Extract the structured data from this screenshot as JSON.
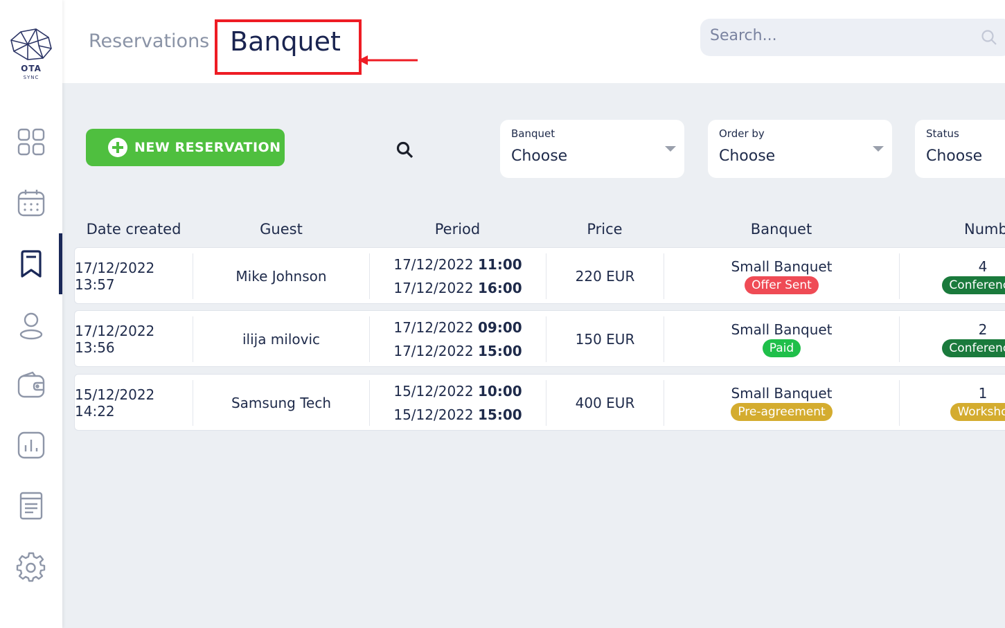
{
  "logo": {
    "line1": "OTA",
    "line2": "SYNC"
  },
  "sidebar": {
    "items": [
      {
        "icon": "dashboard-icon"
      },
      {
        "icon": "calendar-icon"
      },
      {
        "icon": "bookmark-icon",
        "active": true
      },
      {
        "icon": "user-icon"
      },
      {
        "icon": "wallet-icon"
      },
      {
        "icon": "chart-icon"
      },
      {
        "icon": "document-icon"
      },
      {
        "icon": "gear-icon"
      }
    ]
  },
  "header": {
    "breadcrumb": "Reservations",
    "title": "Banquet",
    "search_placeholder": "Search..."
  },
  "toolbar": {
    "new_reservation_label": "NEW RESERVATION",
    "filters": [
      {
        "label": "Banquet",
        "value": "Choose"
      },
      {
        "label": "Order by",
        "value": "Choose"
      },
      {
        "label": "Status",
        "value": "Choose"
      }
    ]
  },
  "table": {
    "headers": [
      "Date created",
      "Guest",
      "Period",
      "Price",
      "Banquet",
      "Numb"
    ],
    "rows": [
      {
        "date_created": "17/12/2022 13:57",
        "guest": "Mike Johnson",
        "period_start_date": "17/12/2022",
        "period_start_time": "11:00",
        "period_end_date": "17/12/2022",
        "period_end_time": "16:00",
        "price": "220 EUR",
        "banquet": "Small Banquet",
        "status": "Offer Sent",
        "status_color": "#ef4b55",
        "number": "4",
        "type": "Conference",
        "type_color": "#1a7a3c"
      },
      {
        "date_created": "17/12/2022 13:56",
        "guest": "ilija milovic",
        "period_start_date": "17/12/2022",
        "period_start_time": "09:00",
        "period_end_date": "17/12/2022",
        "period_end_time": "15:00",
        "price": "150 EUR",
        "banquet": "Small Banquet",
        "status": "Paid",
        "status_color": "#1fbf4a",
        "number": "2",
        "type": "Conference",
        "type_color": "#1a7a3c"
      },
      {
        "date_created": "15/12/2022 14:22",
        "guest": "Samsung Tech",
        "period_start_date": "15/12/2022",
        "period_start_time": "10:00",
        "period_end_date": "15/12/2022",
        "period_end_time": "15:00",
        "price": "400 EUR",
        "banquet": "Small Banquet",
        "status": "Pre-agreement",
        "status_color": "#d4ac2f",
        "number": "1",
        "type": "Worksho",
        "type_color": "#d4ac2f"
      }
    ]
  },
  "colors": {
    "accent_green": "#4fbf3f",
    "highlight_red": "#ee1c24",
    "navy": "#1a2858"
  }
}
